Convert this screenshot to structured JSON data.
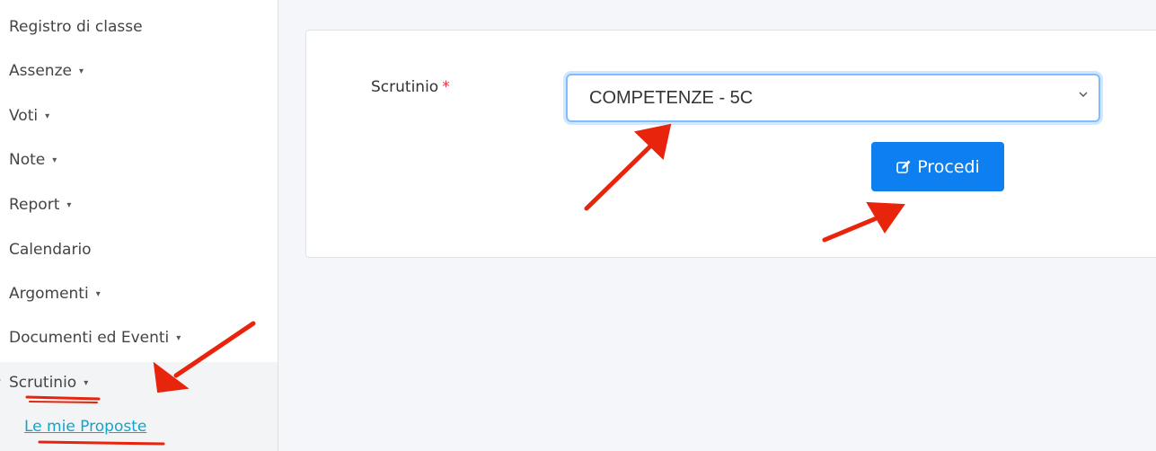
{
  "sidebar": {
    "items": [
      {
        "icon": "book-icon",
        "glyph": "⁾",
        "label": "Registro di classe",
        "caret": ""
      },
      {
        "icon": "user-times-icon",
        "glyph": "",
        "label": "Assenze",
        "caret": "▾"
      },
      {
        "icon": "pencil-icon",
        "glyph": "⁅",
        "label": "Voti",
        "caret": "▾"
      },
      {
        "icon": "sticky-note-icon",
        "glyph": "",
        "label": "Note",
        "caret": "▾"
      },
      {
        "icon": "chart-icon",
        "glyph": "⁏",
        "label": "Report",
        "caret": "▾"
      },
      {
        "icon": "calendar-icon",
        "glyph": "⁆",
        "label": "Calendario",
        "caret": ""
      },
      {
        "icon": "bookmark-icon",
        "glyph": "›",
        "label": "Argomenti",
        "caret": "▾"
      },
      {
        "icon": "file-icon",
        "glyph": "ǐ",
        "label": "Documenti ed Eventi",
        "caret": "▾"
      },
      {
        "icon": "flag-icon",
        "glyph": "⁼",
        "label": "Scrutinio",
        "caret": "▾"
      }
    ],
    "submenu": {
      "label": "Le mie Proposte"
    }
  },
  "form": {
    "label": "Scrutinio",
    "required_mark": "*",
    "select_value": "COMPETENZE - 5C",
    "button_label": "Procedi",
    "button_icon": "edit-icon"
  },
  "colors": {
    "primary": "#0d7ff0",
    "link": "#17a2c8",
    "required": "#dc3545",
    "annotation": "#e8240c"
  }
}
